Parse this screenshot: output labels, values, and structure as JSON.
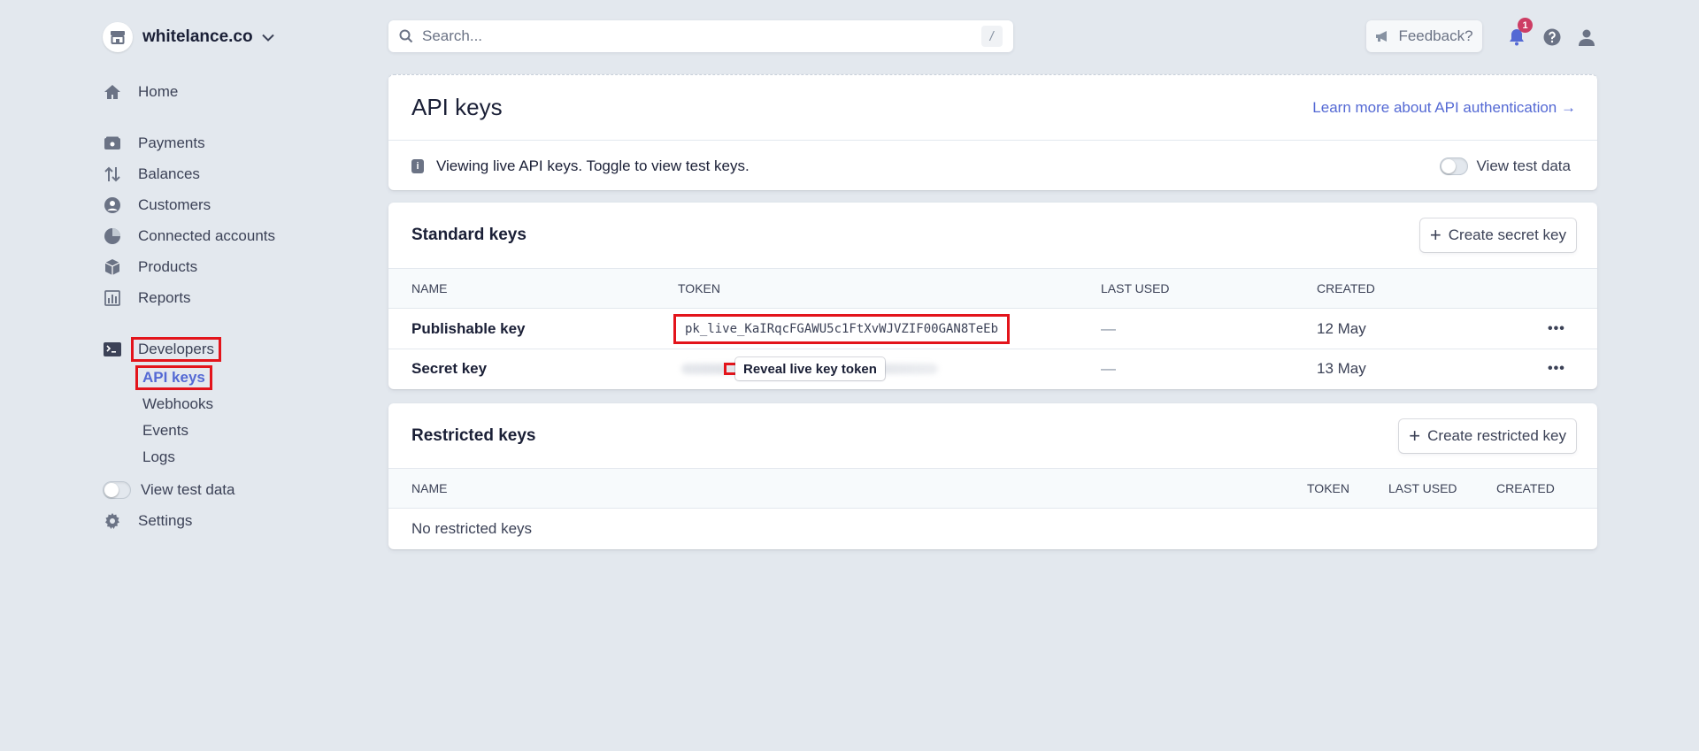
{
  "account": {
    "name": "whitelance.co"
  },
  "sidebar": {
    "home": "Home",
    "items": [
      "Payments",
      "Balances",
      "Customers",
      "Connected accounts",
      "Products",
      "Reports"
    ],
    "developers": "Developers",
    "dev_items": [
      "API keys",
      "Webhooks",
      "Events",
      "Logs"
    ],
    "view_test_data": "View test data",
    "settings": "Settings"
  },
  "topbar": {
    "search_placeholder": "Search...",
    "search_shortcut": "/",
    "feedback": "Feedback?",
    "notification_count": "1"
  },
  "api": {
    "title": "API keys",
    "learn_more": "Learn more about API authentication →",
    "info": "Viewing live API keys. Toggle to view test keys.",
    "view_test_data": "View test data"
  },
  "standard": {
    "title": "Standard keys",
    "create_button": "Create secret key",
    "columns": [
      "NAME",
      "TOKEN",
      "LAST USED",
      "CREATED"
    ],
    "rows": [
      {
        "name": "Publishable key",
        "token": "pk_live_KaIRqcFGAWU5c1FtXvWJVZIF00GAN8TeEb",
        "last_used": "—",
        "created": "12 May"
      },
      {
        "name": "Secret key",
        "reveal": "Reveal live key token",
        "last_used": "—",
        "created": "13 May"
      }
    ]
  },
  "restricted": {
    "title": "Restricted keys",
    "create_button": "Create restricted key",
    "columns": [
      "NAME",
      "TOKEN",
      "LAST USED",
      "CREATED"
    ],
    "empty": "No restricted keys"
  },
  "colors": {
    "accent": "#5469d4",
    "highlight": "#e3141b",
    "background": "#e3e8ee",
    "badge": "#cd3d64"
  }
}
